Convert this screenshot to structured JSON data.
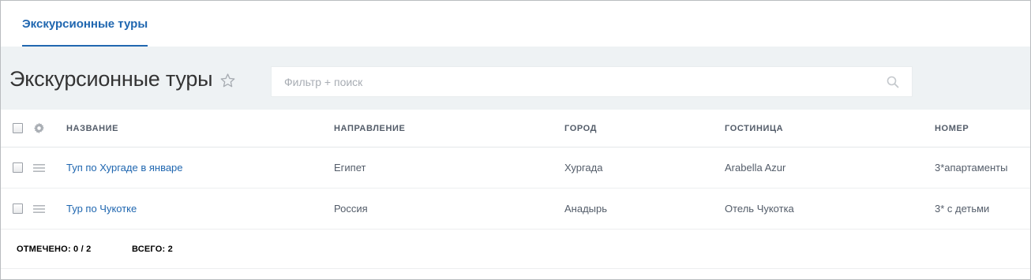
{
  "tabs": [
    {
      "label": "Экскурсионные туры",
      "active": true
    }
  ],
  "page": {
    "title": "Экскурсионные туры"
  },
  "search": {
    "placeholder": "Фильтр + поиск",
    "value": ""
  },
  "grid": {
    "columns": [
      "НАЗВАНИЕ",
      "НАПРАВЛЕНИЕ",
      "ГОРОД",
      "ГОСТИНИЦА",
      "НОМЕР"
    ],
    "rows": [
      {
        "name": "Туп по Хургаде в январе",
        "direction": "Египет",
        "city": "Хургада",
        "hotel": "Arabella Azur",
        "room": "3*апартаменты"
      },
      {
        "name": "Тур по Чукотке",
        "direction": "Россия",
        "city": "Анадырь",
        "hotel": "Отель Чукотка",
        "room": "3* с детьми"
      }
    ]
  },
  "footer": {
    "selected_label": "ОТМЕЧЕНО: 0 / 2",
    "total_label": "ВСЕГО: 2"
  },
  "colors": {
    "accent": "#2067b0",
    "header_bg": "#eef2f4",
    "text": "#535c69"
  },
  "icons": [
    "star-icon",
    "search-icon",
    "gear-icon",
    "menu-icon"
  ]
}
